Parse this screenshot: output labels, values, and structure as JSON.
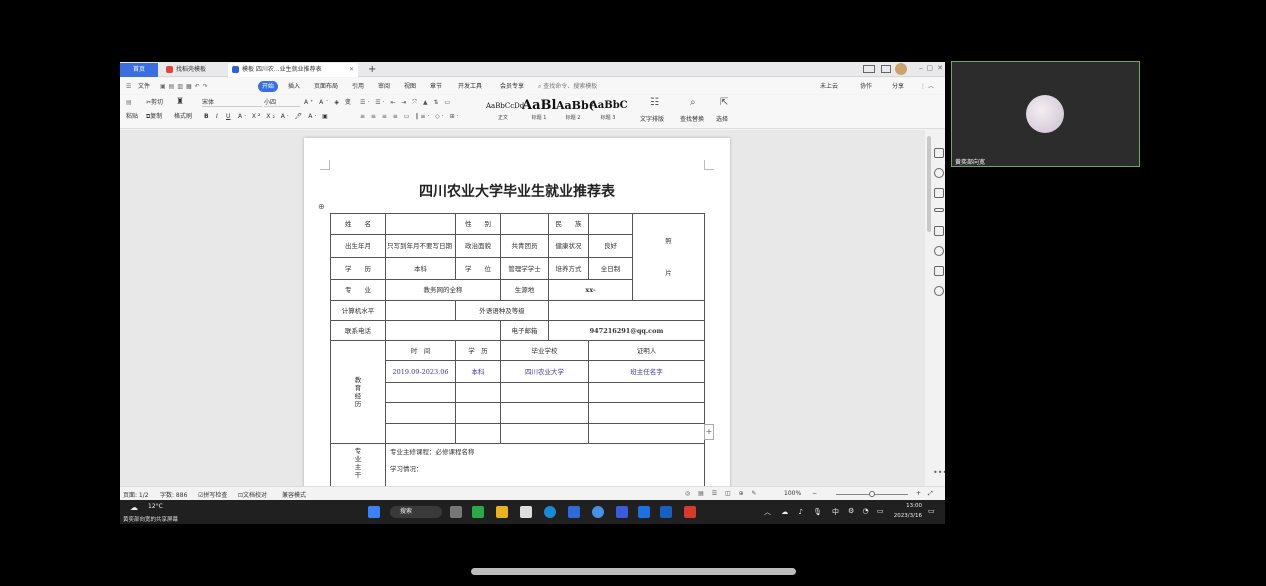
{
  "wps": {
    "tabs": [
      {
        "label": "首页"
      },
      {
        "label": "找稻壳模板"
      },
      {
        "label": "模板 四川农...业生就业推荐表"
      }
    ],
    "add_tab": "+",
    "menus": [
      "文件",
      "开始",
      "插入",
      "页面布局",
      "引用",
      "审阅",
      "视图",
      "章节",
      "开发工具",
      "会员专享"
    ],
    "search_placeholder": "查找命令、搜索模板",
    "right_actions": [
      "未上云",
      "协作",
      "分享"
    ],
    "ribbon": {
      "paste": "粘贴",
      "cut": "剪切",
      "copy": "复制",
      "format_painter": "格式刷",
      "font_name": "宋体",
      "font_size": "小四",
      "styles": [
        {
          "sample": "AaBbCcDd",
          "name": "正文"
        },
        {
          "sample": "AaBl",
          "name": "标题 1"
        },
        {
          "sample": "AaBb(",
          "name": "标题 2"
        },
        {
          "sample": "AaBbC",
          "name": "标题 3"
        }
      ],
      "text_layout": "文字排版",
      "find_replace": "查找替换",
      "select": "选择"
    }
  },
  "document": {
    "title": "四川农业大学毕业生就业推荐表",
    "form": {
      "r1": [
        "姓　　名",
        "",
        "性　　别",
        "",
        "民　　族",
        ""
      ],
      "photo": "照\n\n\n\n片",
      "r2": [
        "出生年月",
        "只写到年月不要写日期",
        "政治面貌",
        "共青团员",
        "健康状况",
        "良好"
      ],
      "r3": [
        "学　　历",
        "本科",
        "学　　位",
        "管理学学士",
        "培养方式",
        "全日制"
      ],
      "r4": [
        "专　　业",
        "教务网的全称",
        "生源地",
        "xx-"
      ],
      "r5": [
        "计算机水平",
        "",
        "外语语种及等级",
        ""
      ],
      "r6": [
        "联系电话",
        "",
        "电子邮箱",
        "947216291@qq.com"
      ],
      "edu_label": "教\n育\n经\n历",
      "edu_headers": [
        "时　间",
        "学　历",
        "毕业学校",
        "证明人"
      ],
      "edu_rows": [
        [
          "2019.09-2023.06",
          "本科",
          "四川农业大学",
          "班主任名字"
        ],
        [
          "",
          "",
          "",
          ""
        ],
        [
          "",
          "",
          "",
          ""
        ],
        [
          "",
          "",
          "",
          ""
        ]
      ],
      "major_label": "专\n业\n主\n干",
      "major_lines": [
        "专业主修课程：必修课程名称",
        "学习情况："
      ]
    }
  },
  "status": {
    "page": "页面: 1/2",
    "words": "字数: 886",
    "spell": "拼写检查",
    "proof": "文档校对",
    "compat": "兼容模式",
    "zoom": "100%"
  },
  "taskbar": {
    "weather_temp": "12°C",
    "search": "搜索",
    "ime": "中",
    "time": "13:00",
    "date": "2023/3/16",
    "share_notice": "黄奕部向宽的共享屏幕"
  },
  "meeting": {
    "participant_name": "黄奕部向宽"
  },
  "colors": {
    "accent": "#3b6fe0",
    "form_blue": "#3a3aa8",
    "video_border": "#6aa86a"
  }
}
